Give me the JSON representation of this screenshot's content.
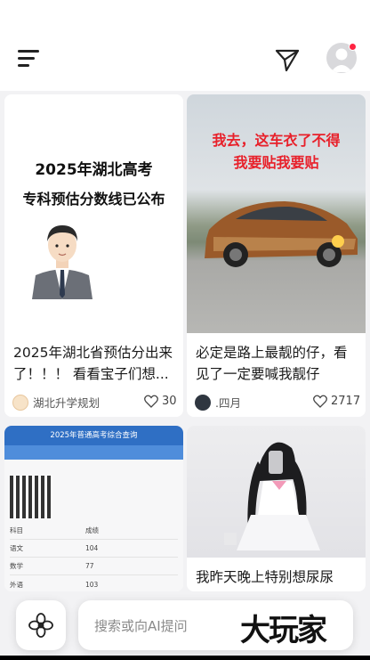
{
  "header": {
    "menu_icon": "menu-icon",
    "send_icon": "paper-plane-icon",
    "avatar_badge_color": "#ff2442"
  },
  "feed": [
    {
      "cover_text_line1": "2025年湖北高考",
      "cover_text_line2": "专科预估分数线已公布",
      "title": "2025年湖北省预估分出来了！！！ 看看宝子们想...",
      "author": "湖北升学规划",
      "likes": "30"
    },
    {
      "cover_text_line1": "我去，这车衣了不得",
      "cover_text_line2": "我要贴我要贴",
      "title": "必定是路上最靓的仔，看见了一定要喊我靓仔",
      "author": ".四月",
      "likes": "2717"
    },
    {
      "cover_header": "2025年普通高考综合查询",
      "cover_rows": [
        {
          "subject": "科目",
          "score": "成绩"
        },
        {
          "subject": "语文",
          "score": "104"
        },
        {
          "subject": "数学",
          "score": "77"
        },
        {
          "subject": "外语",
          "score": "103"
        }
      ]
    },
    {
      "title": "我昨天晚上特别想尿尿"
    }
  ],
  "bottom": {
    "search_placeholder": "搜索或向AI提问",
    "watermark": "大玩家"
  }
}
